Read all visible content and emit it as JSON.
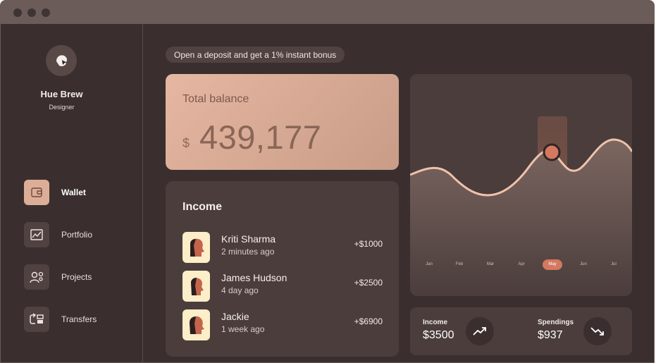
{
  "profile": {
    "name": "Hue Brew",
    "role": "Designer"
  },
  "nav": [
    {
      "label": "Wallet",
      "icon": "wallet-icon",
      "active": true
    },
    {
      "label": "Portfolio",
      "icon": "chart-icon",
      "active": false
    },
    {
      "label": "Projects",
      "icon": "team-icon",
      "active": false
    },
    {
      "label": "Transfers",
      "icon": "transfer-icon",
      "active": false
    }
  ],
  "promo": "Open a deposit and get a 1% instant bonus",
  "balance": {
    "title": "Total balance",
    "currency": "$",
    "amount": "439,177"
  },
  "income": {
    "title": "Income",
    "transactions": [
      {
        "name": "Kriti Sharma",
        "time": "2 minutes ago",
        "amount": "+$1000"
      },
      {
        "name": "James Hudson",
        "time": "4 day ago",
        "amount": "+$2500"
      },
      {
        "name": "Jackie",
        "time": "1 week ago",
        "amount": "+$6900"
      }
    ]
  },
  "chart": {
    "months": [
      "Jan",
      "Feb",
      "Mar",
      "Apr",
      "May",
      "Jun",
      "Jul"
    ],
    "selected_month": "May"
  },
  "stats": {
    "income": {
      "label": "Income",
      "value": "$3500",
      "icon": "trend-up-icon"
    },
    "spendings": {
      "label": "Spendings",
      "value": "$937",
      "icon": "trend-down-icon"
    }
  },
  "colors": {
    "accent": "#d4785f",
    "balance_card": "#dcae98",
    "background": "#3a2f2e",
    "card": "#4a3d3c"
  }
}
